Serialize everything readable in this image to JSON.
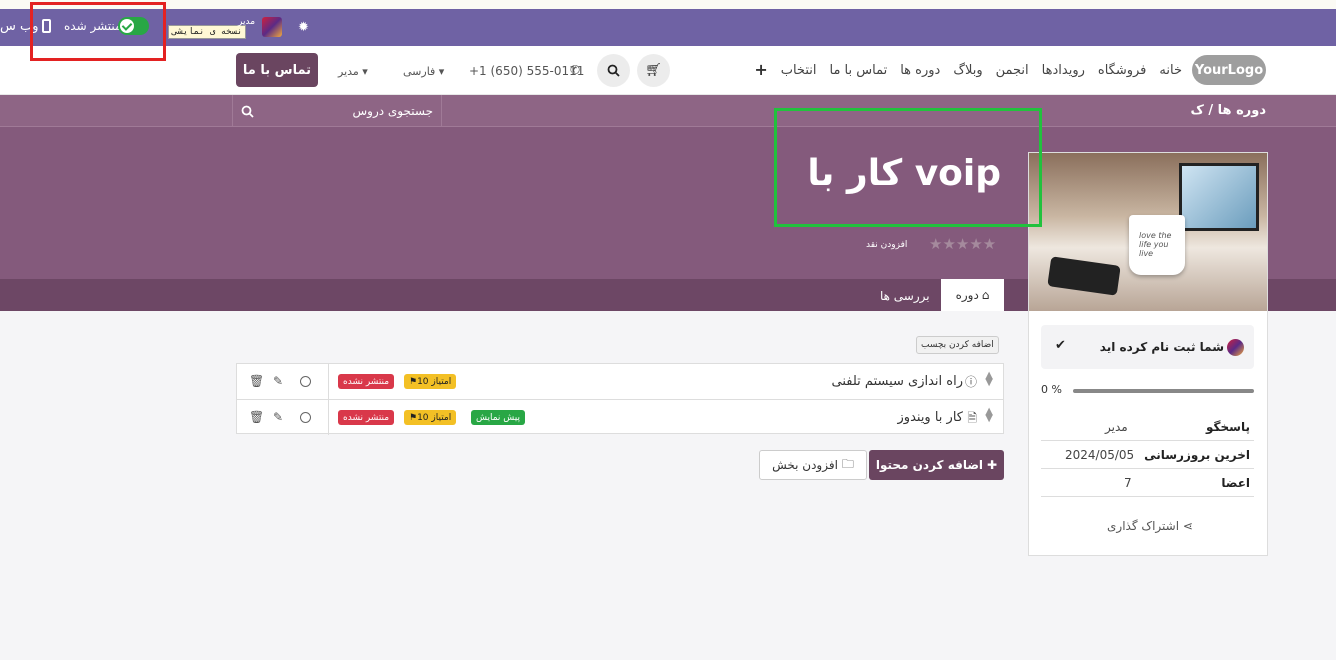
{
  "editbar": {
    "website_label": "وب س",
    "published_label": "منتشر شده",
    "published": true,
    "demo_badge": "نسخه ی نمایشی",
    "admin_name": "مدیر",
    "icons": [
      "mobile-icon",
      "toggle-switch",
      "bug-icon"
    ]
  },
  "navbar": {
    "logo": "YourLogo",
    "menu": [
      "خانه",
      "فروشگاه",
      "رویدادها",
      "انجمن",
      "وبلاگ",
      "دوره ها",
      "تماس با ما",
      "انتخاب"
    ],
    "plus": "+",
    "phone": "+1 (650) 555-0111",
    "language": "فارسی",
    "user": "مدیر",
    "contact_button": "تماس با ما"
  },
  "hero": {
    "breadcrumb_root": "دوره ها",
    "breadcrumb_sep": "/",
    "breadcrumb_current": "ک",
    "search_placeholder": "جستجوی دروس",
    "course_title": "کار با voip",
    "rating_stars": 5,
    "rating_filled": 0,
    "add_review": "افزودن نقد",
    "tab_course": "دوره",
    "tab_reviews": "بررسی ها"
  },
  "sidebar": {
    "photo_text": "love the life you live",
    "enrolled_text": "شما ثبت نام کرده اید",
    "progress_label": "0 %",
    "progress_value": 0,
    "rows": [
      {
        "key": "پاسخگو",
        "value": "مدیر"
      },
      {
        "key": "اخرین بروزرسانی",
        "value": "2024/05/05"
      },
      {
        "key": "اعضا",
        "value": "7"
      }
    ],
    "share_label": "اشتراک گذاری"
  },
  "content": {
    "add_tag": "اضافه کردن بچسب",
    "rows": [
      {
        "title": "راه اندازی سیستم تلفنی",
        "type_icon": "question-icon",
        "points": "10 امتیاز",
        "status": "منتشر نشده",
        "preview": ""
      },
      {
        "title": "کار با ویندوز",
        "type_icon": "pdf-icon",
        "points": "10 امتیاز",
        "status": "منتشر نشده",
        "preview": "پیش نمایش"
      }
    ],
    "add_content_button": "اضافه کردن محتوا",
    "add_section_button": "افزودن بخش"
  },
  "colors": {
    "editbar": "#6f62a4",
    "hero": "#845a7c",
    "primary": "#6a4560",
    "badge_red": "#d9384a",
    "badge_yellow": "#f3c025",
    "badge_green": "#28a745",
    "highlight_red": "#e32222",
    "highlight_green": "#21c23d"
  }
}
